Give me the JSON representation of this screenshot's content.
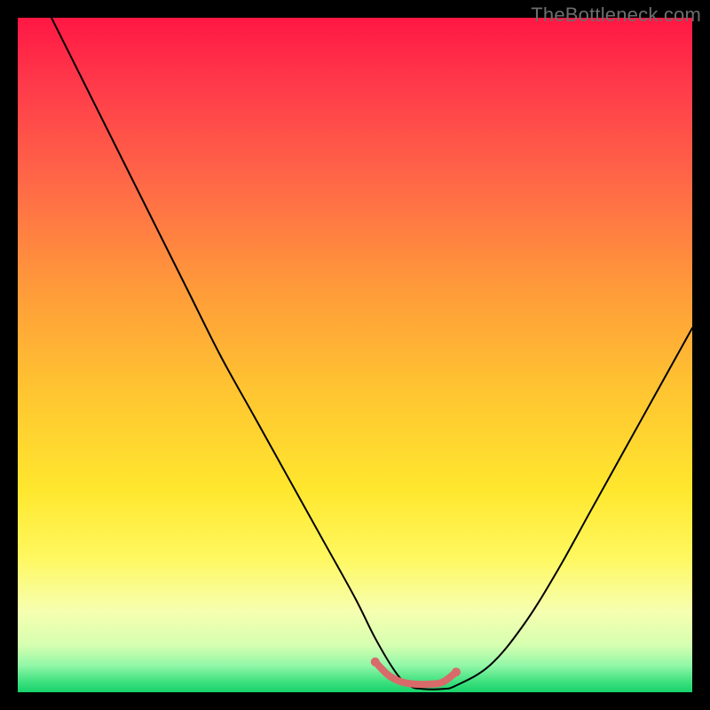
{
  "watermark": "TheBottleneck.com",
  "colors": {
    "frame": "#000000",
    "curve_stroke": "#000000",
    "band_stroke": "#d86a6a",
    "gradient_stops": [
      {
        "offset": 0.0,
        "color": "#ff1744"
      },
      {
        "offset": 0.1,
        "color": "#ff3a4a"
      },
      {
        "offset": 0.25,
        "color": "#ff6a47"
      },
      {
        "offset": 0.4,
        "color": "#ff9a3a"
      },
      {
        "offset": 0.55,
        "color": "#ffc431"
      },
      {
        "offset": 0.7,
        "color": "#ffe72e"
      },
      {
        "offset": 0.8,
        "color": "#fff85f"
      },
      {
        "offset": 0.88,
        "color": "#f6ffb0"
      },
      {
        "offset": 0.93,
        "color": "#d6ffb0"
      },
      {
        "offset": 0.96,
        "color": "#93f7a8"
      },
      {
        "offset": 0.985,
        "color": "#3de07e"
      },
      {
        "offset": 1.0,
        "color": "#17d26b"
      }
    ]
  },
  "chart_data": {
    "type": "line",
    "title": "",
    "xlabel": "",
    "ylabel": "",
    "xlim": [
      0,
      100
    ],
    "ylim": [
      0,
      100
    ],
    "grid": false,
    "legend": false,
    "series": [
      {
        "name": "bottleneck-curve",
        "x": [
          5,
          10,
          15,
          20,
          25,
          30,
          35,
          40,
          45,
          50,
          53,
          56,
          58,
          60,
          63,
          65,
          70,
          75,
          80,
          85,
          90,
          95,
          100
        ],
        "y": [
          100,
          90,
          80,
          70,
          60,
          50,
          41,
          32,
          23,
          14,
          8,
          3,
          1,
          0.5,
          0.5,
          1,
          4,
          10,
          18,
          27,
          36,
          45,
          54
        ]
      },
      {
        "name": "optimal-band",
        "x": [
          53,
          55,
          57,
          59,
          61,
          63,
          65
        ],
        "y": [
          4.5,
          2.5,
          1.5,
          1.2,
          1.2,
          1.5,
          3.0
        ]
      }
    ],
    "annotations": []
  }
}
